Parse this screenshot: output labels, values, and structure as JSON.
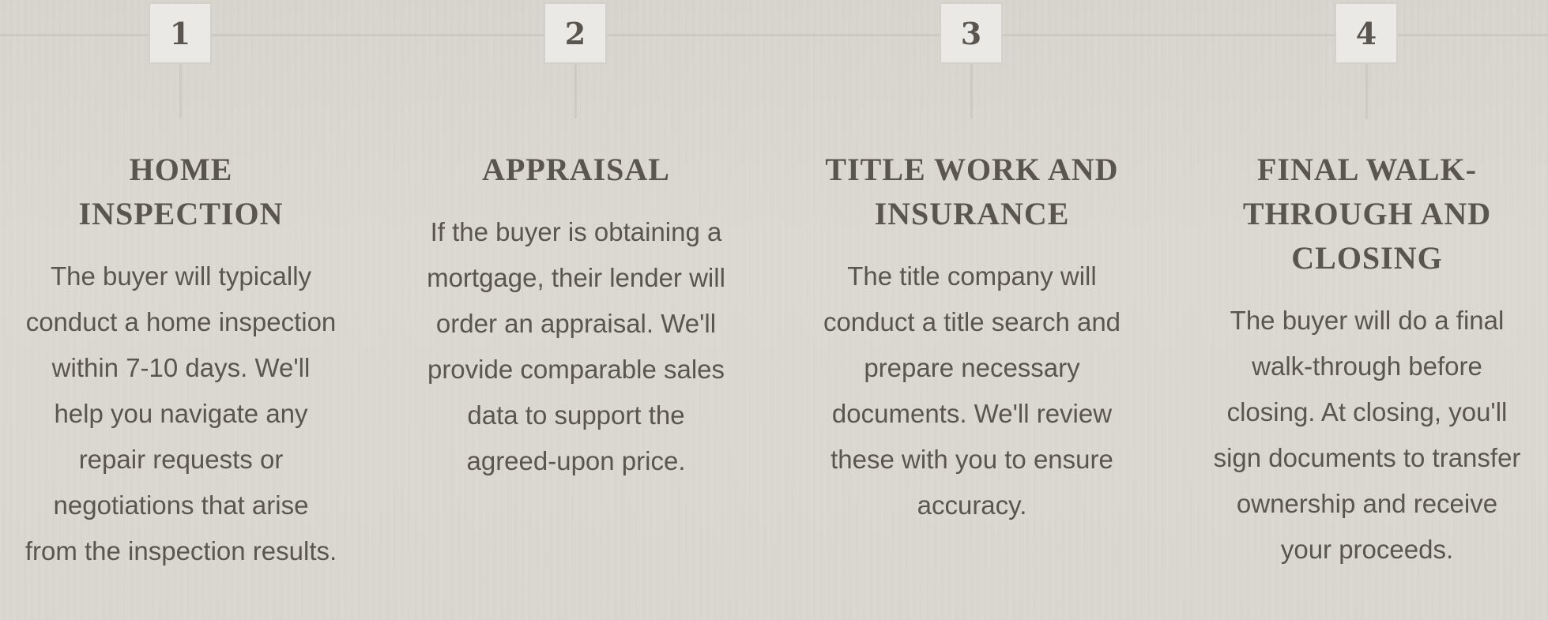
{
  "steps": [
    {
      "number": "1",
      "title": "Home Inspection",
      "text": "The buyer will typically conduct a home inspection within 7-10 days. We'll help you navigate any repair requests or negotiations that arise from the inspection results."
    },
    {
      "number": "2",
      "title": "Appraisal",
      "text": "If the buyer is obtaining a mortgage, their lender will order an appraisal. We'll provide comparable sales data to support the agreed-upon price."
    },
    {
      "number": "3",
      "title": "Title Work and Insurance",
      "text": "The title company will conduct a title search and prepare necessary documents. We'll review these with you to ensure accuracy."
    },
    {
      "number": "4",
      "title": "Final Walk-through and Closing",
      "text": "The buyer will do a final walk-through before closing. At closing, you'll sign documents to transfer ownership and receive your proceeds."
    }
  ]
}
